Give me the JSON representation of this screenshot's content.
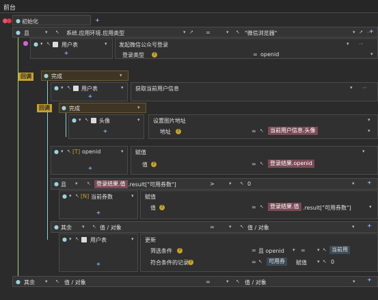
{
  "header": {
    "title": "前台"
  },
  "root": {
    "label": "初始化"
  },
  "cond1": {
    "left": "且",
    "path": "系统.应用环境.应用类型",
    "op": "=",
    "right": "\"微信浏览器\""
  },
  "users1": {
    "owner": "用户表",
    "action": "发起微信公众号登录",
    "param_label": "登录类型",
    "param_value": "openid"
  },
  "callback1": {
    "tag": "回调",
    "label": "完成"
  },
  "users2": {
    "owner": "用户表",
    "action": "获取当前用户信息"
  },
  "callback2": {
    "tag": "回调",
    "label": "完成"
  },
  "avatar": {
    "owner": "头像",
    "action": "设置图片地址",
    "param_label": "地址",
    "value": "当前用户信息.头像"
  },
  "openid": {
    "owner": "openid",
    "action": "赋值",
    "param_label": "值",
    "value": "登录结果.openid"
  },
  "cond2": {
    "left": "且",
    "expr_a": "登录结果.值",
    "expr_b": ".result[\"可用券数\"]",
    "op": ">",
    "right": "0"
  },
  "coupon": {
    "owner": "当前券数",
    "action": "赋值",
    "param_label": "值",
    "value_a": "登录结果.值",
    "value_b": ".result[\"可用券数\"]"
  },
  "else1": {
    "label": "其余",
    "left": "值 / 对象",
    "op": "=",
    "right": "值 / 对象"
  },
  "update": {
    "owner": "用户表",
    "action": "更新",
    "filter_label": "筛选条件",
    "filter_a": "且 openid",
    "filter_op": "=",
    "filter_b": "当前用",
    "record_label": "符合条件的记录",
    "rec_a": "可用券",
    "rec_b": "赋值",
    "rec_c": "0"
  },
  "else2": {
    "label": "其余",
    "left": "值 / 对象",
    "op": "=",
    "right": "值 / 对象"
  },
  "colors": {
    "accent": "#8ab6ff",
    "callback": "#c9a227",
    "green_wire": "#a7d36f",
    "teal_wire": "#8bd0d9",
    "orange_wire": "#ff8b3d"
  }
}
